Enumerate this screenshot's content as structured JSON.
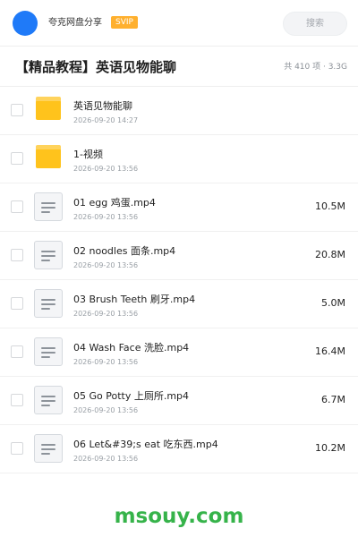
{
  "header": {
    "user_name": "夸克网盘分享",
    "badge": "SVIP",
    "search_placeholder": "搜索"
  },
  "share": {
    "title": "【精品教程】英语见物能聊",
    "meta": "共 410 项 · 3.3G"
  },
  "files": [
    {
      "type": "folder",
      "name": "英语见物能聊",
      "date": "2026-09-20 14:27",
      "size": ""
    },
    {
      "type": "folder",
      "name": "1-视频",
      "date": "2026-09-20 13:56",
      "size": ""
    },
    {
      "type": "file",
      "name": "01 egg 鸡蛋.mp4",
      "date": "2026-09-20 13:56",
      "size": "10.5M"
    },
    {
      "type": "file",
      "name": "02 noodles 面条.mp4",
      "date": "2026-09-20 13:56",
      "size": "20.8M"
    },
    {
      "type": "file",
      "name": "03 Brush Teeth 刷牙.mp4",
      "date": "2026-09-20 13:56",
      "size": "5.0M"
    },
    {
      "type": "file",
      "name": "04 Wash Face 洗脸.mp4",
      "date": "2026-09-20 13:56",
      "size": "16.4M"
    },
    {
      "type": "file",
      "name": "05 Go Potty 上厕所.mp4",
      "date": "2026-09-20 13:56",
      "size": "6.7M"
    },
    {
      "type": "file",
      "name": "06 Let&#39;s eat 吃东西.mp4",
      "date": "2026-09-20 13:56",
      "size": "10.2M"
    }
  ],
  "watermark": "msouy.com",
  "colors": {
    "avatar": "#1f7af8",
    "svip": "#ffb02e",
    "folder": "#ffc31c",
    "watermark": "#36b34a"
  }
}
